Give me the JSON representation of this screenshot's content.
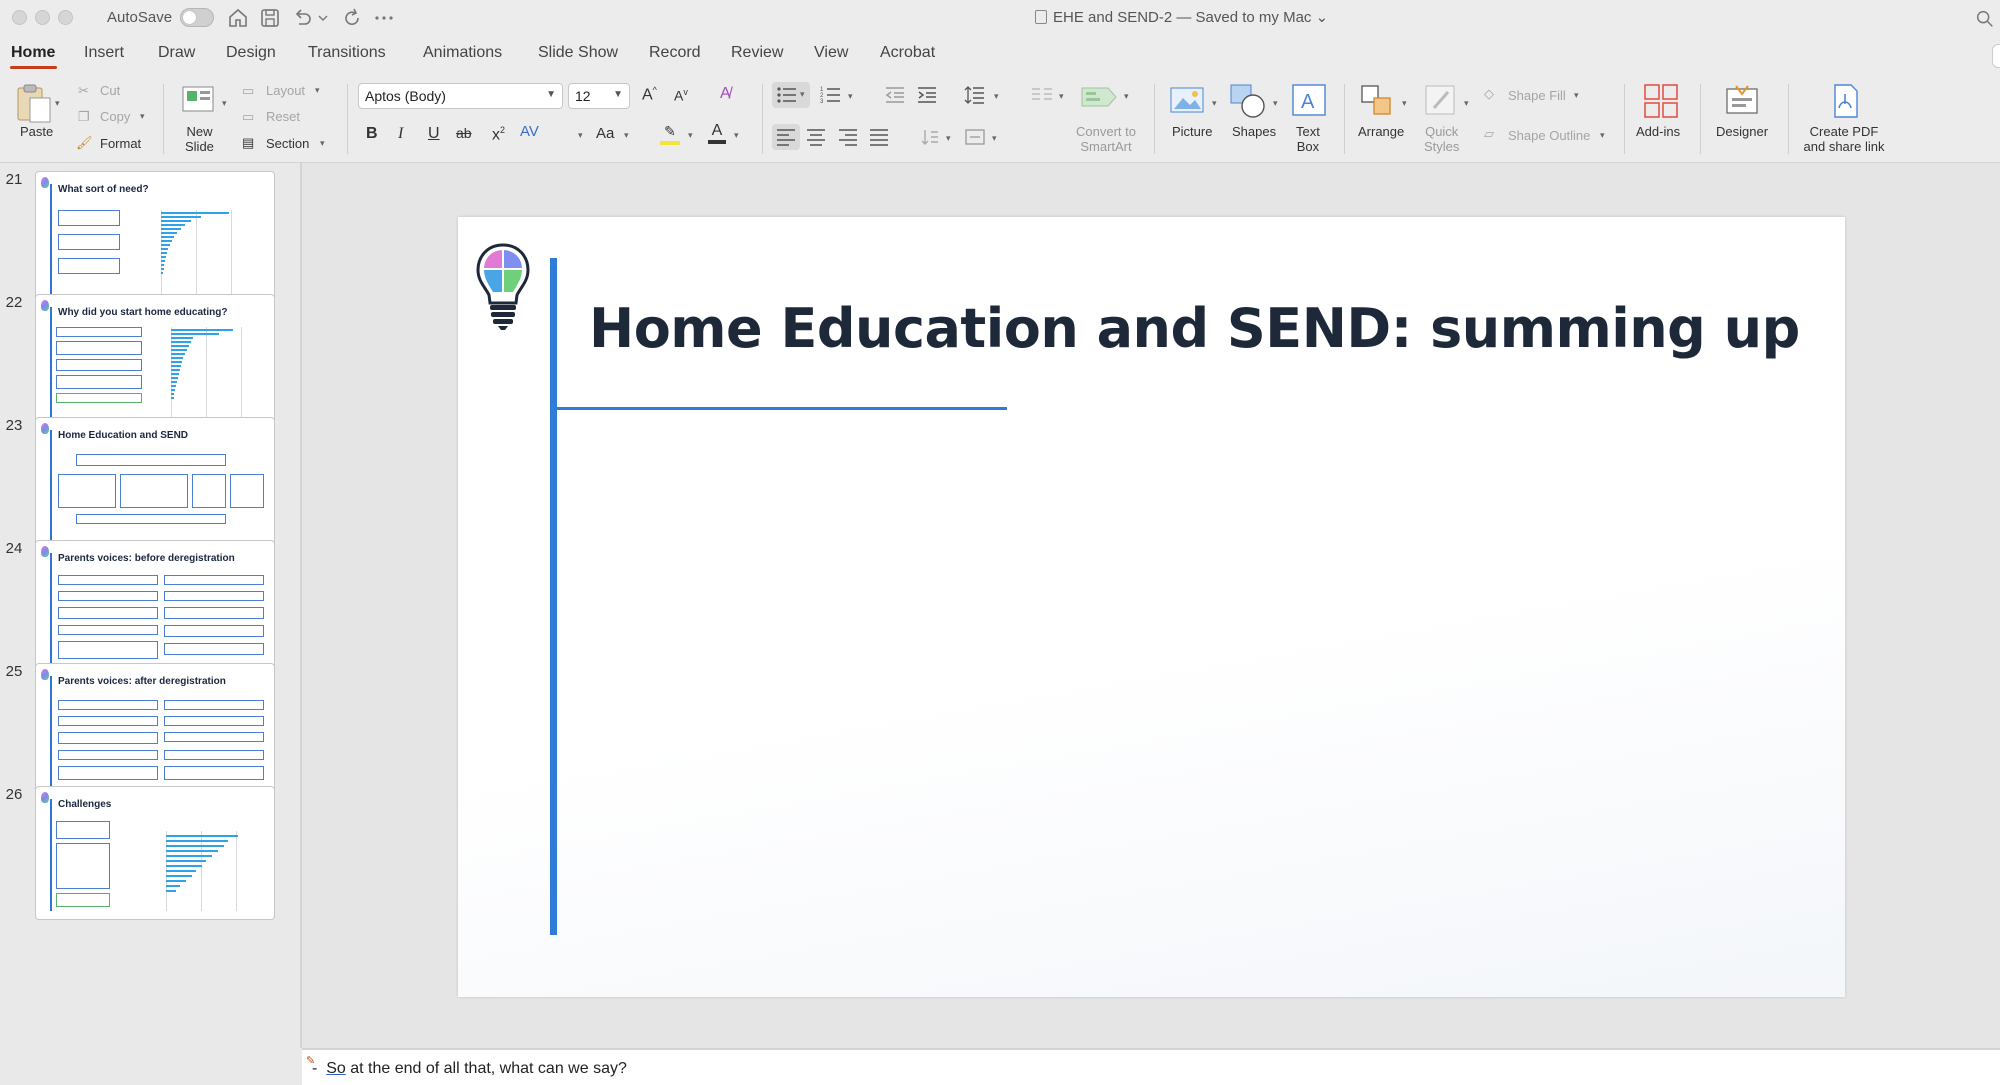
{
  "titlebar": {
    "autosave_label": "AutoSave",
    "doc_title": "EHE and SEND-2 — Saved to my Mac",
    "title_caret": "⌄"
  },
  "tabs": [
    "Home",
    "Insert",
    "Draw",
    "Design",
    "Transitions",
    "Animations",
    "Slide Show",
    "Record",
    "Review",
    "View",
    "Acrobat"
  ],
  "ribbon": {
    "paste": "Paste",
    "cut": "Cut",
    "copy": "Copy",
    "format": "Format",
    "new_slide": [
      "New",
      "Slide"
    ],
    "layout": "Layout",
    "reset": "Reset",
    "section": "Section",
    "font_name": "Aptos (Body)",
    "font_size": "12",
    "grow_font": "A",
    "shrink_font": "A",
    "bold": "B",
    "italic": "I",
    "underline": "U",
    "strike": "ab",
    "superscript": "x",
    "spacing": "AV",
    "change_case": "Aa",
    "font_color": "A",
    "convert_smartart": [
      "Convert to",
      "SmartArt"
    ],
    "picture": "Picture",
    "shapes": "Shapes",
    "text_box": [
      "Text",
      "Box"
    ],
    "arrange": "Arrange",
    "quick_styles": [
      "Quick",
      "Styles"
    ],
    "shape_fill": "Shape Fill",
    "shape_outline": "Shape Outline",
    "addins": "Add-ins",
    "designer": "Designer",
    "create_pdf": [
      "Create PDF",
      "and share link"
    ]
  },
  "slides": [
    {
      "num": "21",
      "title": "What sort of need?"
    },
    {
      "num": "22",
      "title": "Why did you start home educating?"
    },
    {
      "num": "23",
      "title": "Home Education and SEND"
    },
    {
      "num": "24",
      "title": "Parents voices: before deregistration"
    },
    {
      "num": "25",
      "title": "Parents voices: after deregistration"
    },
    {
      "num": "26",
      "title": "Challenges"
    }
  ],
  "current_slide": {
    "title": "Home Education and SEND: summing up"
  },
  "notes": {
    "first_word": "So",
    "rest": " at the end of all that, what can we say?"
  },
  "colors": {
    "accent_blue": "#2f7bd8",
    "tab_underline": "#c43e1c",
    "title_text": "#1d2838"
  }
}
